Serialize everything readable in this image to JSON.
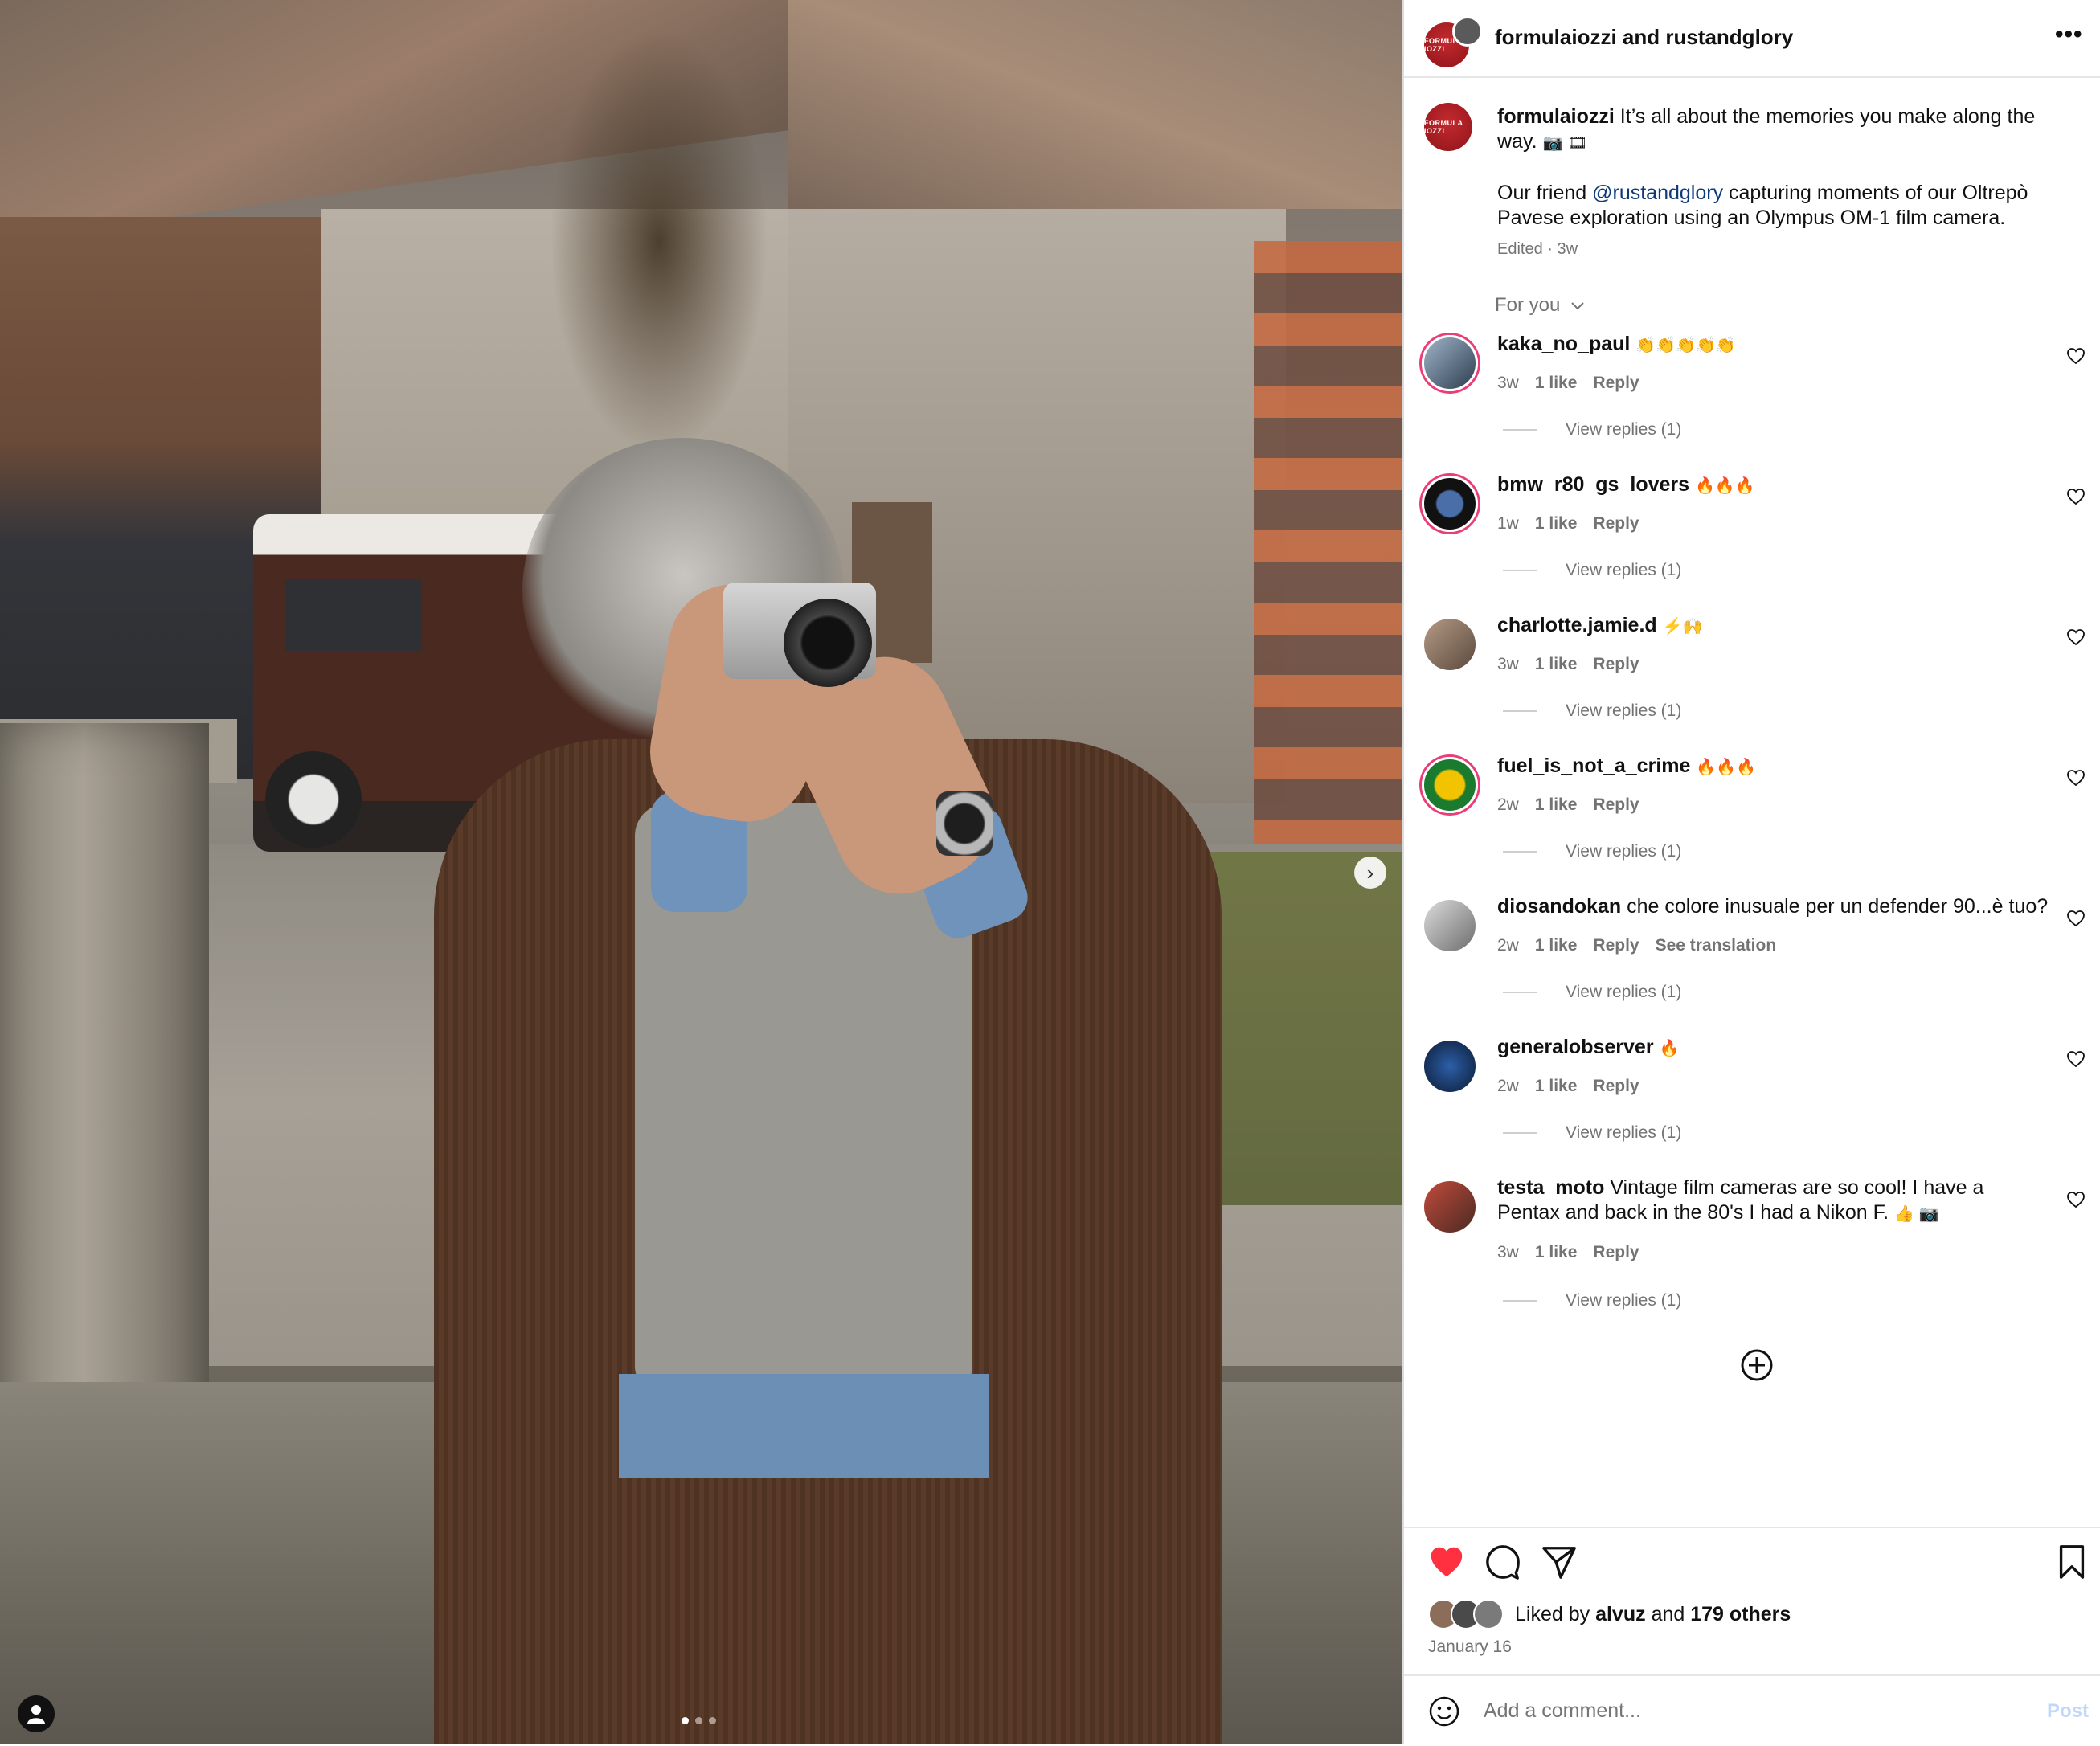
{
  "post": {
    "header_title": "formulaiozzi and rustandglory",
    "brand_text": "FORMULA IOZZI",
    "more_label": "•••",
    "next_label": "›",
    "carousel_count": 3
  },
  "caption": {
    "username": "formulaiozzi",
    "line1": "It’s all about the memories you make along the way.",
    "emoji1": "📷 🎞",
    "line2_pre": "Our friend",
    "mention": "@rustandglory",
    "line2_post": "capturing moments of our Oltrepò Pavese exploration using an Olympus OM-1 film camera.",
    "meta": "Edited · 3w"
  },
  "for_you": "For you",
  "comments": [
    {
      "username": "kaka_no_paul",
      "text": "",
      "emoji": "👏👏👏👏👏",
      "time": "3w",
      "likes": "1 like",
      "reply": "Reply",
      "translation": "",
      "replies": "View replies (1)"
    },
    {
      "username": "bmw_r80_gs_lovers",
      "text": "",
      "emoji": "🔥🔥🔥",
      "time": "1w",
      "likes": "1 like",
      "reply": "Reply",
      "translation": "",
      "replies": "View replies (1)"
    },
    {
      "username": "charlotte.jamie.d",
      "text": "",
      "emoji": "⚡🙌",
      "time": "3w",
      "likes": "1 like",
      "reply": "Reply",
      "translation": "",
      "replies": "View replies (1)"
    },
    {
      "username": "fuel_is_not_a_crime",
      "text": "",
      "emoji": "🔥🔥🔥",
      "time": "2w",
      "likes": "1 like",
      "reply": "Reply",
      "translation": "",
      "replies": "View replies (1)"
    },
    {
      "username": "diosandokan",
      "text": "che colore inusuale per un defender 90...è tuo?",
      "emoji": "",
      "time": "2w",
      "likes": "1 like",
      "reply": "Reply",
      "translation": "See translation",
      "replies": "View replies (1)"
    },
    {
      "username": "generalobserver",
      "text": "",
      "emoji": "🔥",
      "time": "2w",
      "likes": "1 like",
      "reply": "Reply",
      "translation": "",
      "replies": "View replies (1)"
    },
    {
      "username": "testa_moto",
      "text": "Vintage film cameras are so cool! I have a Pentax and back in the 80's I had a Nikon F.",
      "emoji": "👍 📷",
      "time": "3w",
      "likes": "1 like",
      "reply": "Reply",
      "translation": "",
      "replies": "View replies (1)"
    }
  ],
  "likes": {
    "prefix": "Liked by",
    "user": "alvuz",
    "middle": "and",
    "others": "179 others"
  },
  "date": "January 16",
  "add_comment": {
    "placeholder": "Add a comment...",
    "post_label": "Post"
  },
  "colors": {
    "like_red": "#ff3040",
    "link_blue": "#0f3a7a",
    "post_disabled": "#c1d9f8"
  }
}
